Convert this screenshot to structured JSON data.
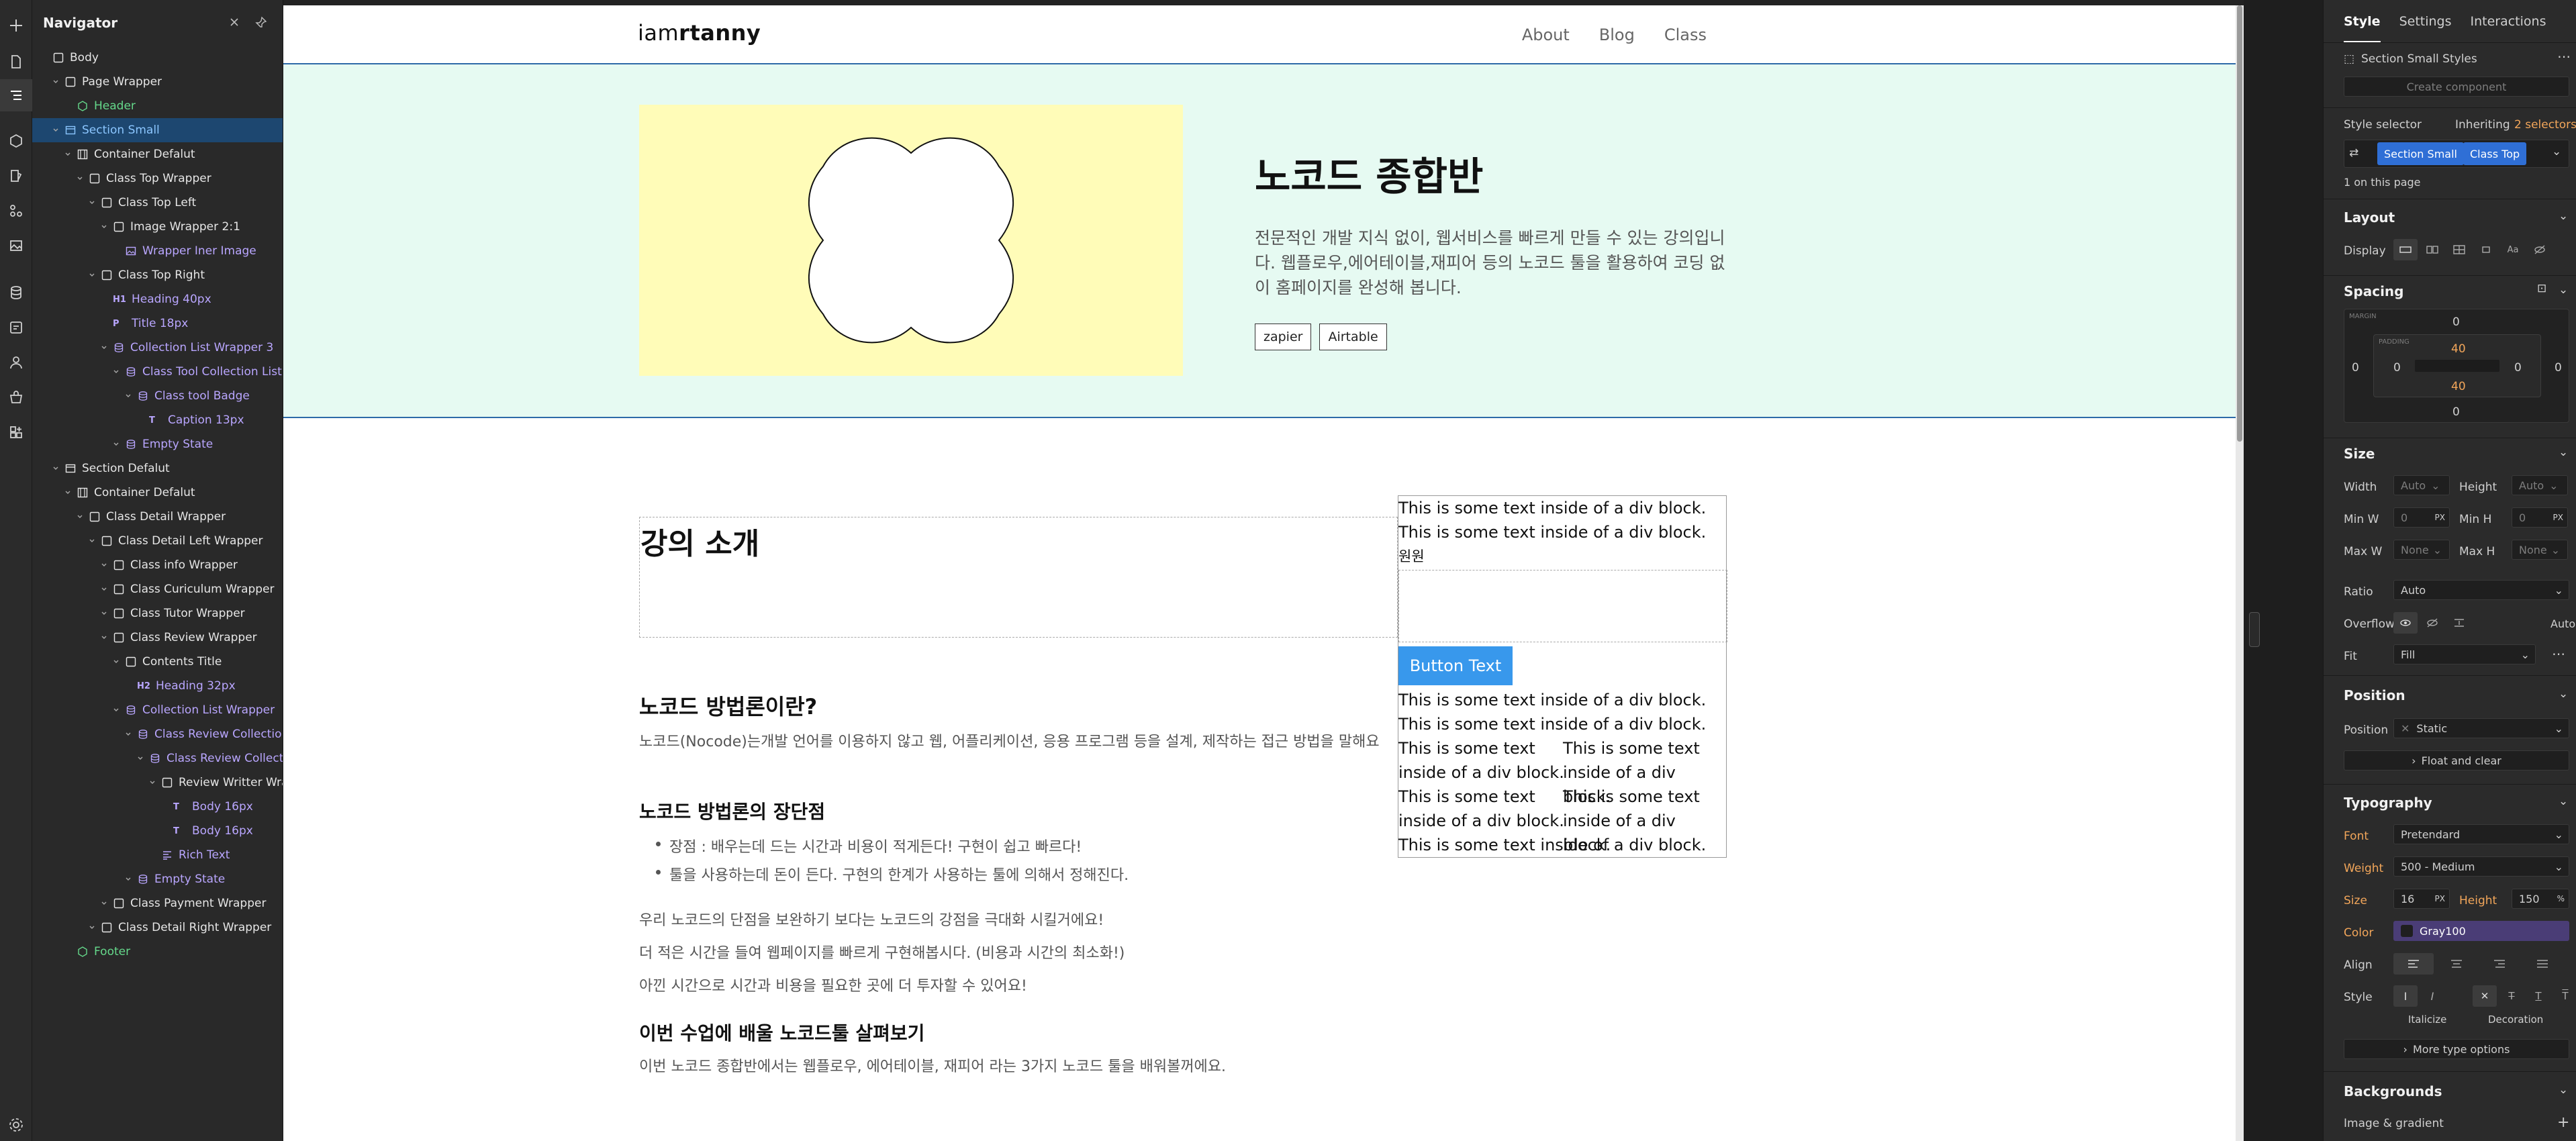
{
  "navigator": {
    "title": "Navigator",
    "tree": [
      {
        "label": "Body",
        "depth": 0,
        "chev": false,
        "icon": "box",
        "color": "w"
      },
      {
        "label": "Page Wrapper",
        "depth": 1,
        "chev": true,
        "icon": "box",
        "color": "w"
      },
      {
        "label": "Header",
        "depth": 2,
        "chev": false,
        "icon": "component",
        "color": "g"
      },
      {
        "label": "Section Small",
        "depth": 1,
        "chev": true,
        "icon": "section",
        "color": "b",
        "selected": true
      },
      {
        "label": "Container Defalut",
        "depth": 2,
        "chev": true,
        "icon": "container",
        "color": "w"
      },
      {
        "label": "Class Top Wrapper",
        "depth": 3,
        "chev": true,
        "icon": "box",
        "color": "w"
      },
      {
        "label": "Class Top Left",
        "depth": 4,
        "chev": true,
        "icon": "box",
        "color": "w"
      },
      {
        "label": "Image Wrapper 2:1",
        "depth": 5,
        "chev": true,
        "icon": "box",
        "color": "w"
      },
      {
        "label": "Wrapper Iner Image",
        "depth": 6,
        "chev": false,
        "icon": "image",
        "color": "p"
      },
      {
        "label": "Class Top Right",
        "depth": 4,
        "chev": true,
        "icon": "box",
        "color": "w"
      },
      {
        "label": "Heading 40px",
        "depth": 5,
        "chev": false,
        "tag": "H1",
        "color": "p"
      },
      {
        "label": "Title 18px",
        "depth": 5,
        "chev": false,
        "tag": "P",
        "color": "p"
      },
      {
        "label": "Collection List Wrapper 3",
        "depth": 5,
        "chev": true,
        "icon": "db",
        "color": "p"
      },
      {
        "label": "Class Tool Collection List",
        "depth": 6,
        "chev": true,
        "icon": "db",
        "color": "p"
      },
      {
        "label": "Class tool Badge",
        "depth": 7,
        "chev": true,
        "icon": "db",
        "color": "p"
      },
      {
        "label": "Caption 13px",
        "depth": 8,
        "chev": false,
        "tag": "T",
        "color": "p"
      },
      {
        "label": "Empty State",
        "depth": 6,
        "chev": true,
        "icon": "db",
        "color": "p"
      },
      {
        "label": "Section Defalut",
        "depth": 1,
        "chev": true,
        "icon": "section",
        "color": "w"
      },
      {
        "label": "Container Defalut",
        "depth": 2,
        "chev": true,
        "icon": "container",
        "color": "w"
      },
      {
        "label": "Class Detail Wrapper",
        "depth": 3,
        "chev": true,
        "icon": "box",
        "color": "w"
      },
      {
        "label": "Class Detail Left Wrapper",
        "depth": 4,
        "chev": true,
        "icon": "box",
        "color": "w"
      },
      {
        "label": "Class info Wrapper",
        "depth": 5,
        "chev": true,
        "icon": "box",
        "color": "w"
      },
      {
        "label": "Class Curiculum Wrapper",
        "depth": 5,
        "chev": true,
        "icon": "box",
        "color": "w"
      },
      {
        "label": "Class Tutor Wrapper",
        "depth": 5,
        "chev": true,
        "icon": "box",
        "color": "w"
      },
      {
        "label": "Class Review Wrapper",
        "depth": 5,
        "chev": true,
        "icon": "box",
        "color": "w"
      },
      {
        "label": "Contents Title",
        "depth": 6,
        "chev": true,
        "icon": "box",
        "color": "w"
      },
      {
        "label": "Heading 32px",
        "depth": 7,
        "chev": false,
        "tag": "H2",
        "color": "p"
      },
      {
        "label": "Collection List Wrapper",
        "depth": 6,
        "chev": true,
        "icon": "db",
        "color": "p"
      },
      {
        "label": "Class Review Collection",
        "depth": 7,
        "chev": true,
        "icon": "db",
        "color": "p"
      },
      {
        "label": "Class Review Collect",
        "depth": 8,
        "chev": true,
        "icon": "db",
        "color": "p"
      },
      {
        "label": "Review Writter Wra",
        "depth": 9,
        "chev": true,
        "icon": "box",
        "color": "w"
      },
      {
        "label": "Body 16px",
        "depth": 10,
        "chev": false,
        "tag": "T",
        "color": "p"
      },
      {
        "label": "Body 16px",
        "depth": 10,
        "chev": false,
        "tag": "T",
        "color": "p"
      },
      {
        "label": "Rich Text",
        "depth": 9,
        "chev": false,
        "icon": "rich",
        "color": "p"
      },
      {
        "label": "Empty State",
        "depth": 7,
        "chev": true,
        "icon": "db",
        "color": "p"
      },
      {
        "label": "Class Payment Wrapper",
        "depth": 5,
        "chev": true,
        "icon": "box",
        "color": "w"
      },
      {
        "label": "Class Detail Right Wrapper",
        "depth": 4,
        "chev": true,
        "icon": "box",
        "color": "w"
      },
      {
        "label": "Footer",
        "depth": 2,
        "chev": false,
        "icon": "component",
        "color": "g"
      }
    ]
  },
  "site": {
    "logo_light": "iam",
    "logo_bold": "rtanny",
    "menu": [
      "About",
      "Blog",
      "Class"
    ],
    "hero_title": "노코드 종합반",
    "hero_desc": "전문적인 개발 지식 없이, 웹서비스를 빠르게 만들 수 있는 강의입니다. 웹플로우,에어테이블,재피어 등의 노코드 툴을 활용하여 코딩 없이 홈페이지를 완성해 봅니다.",
    "badges": [
      "zapier",
      "Airtable"
    ],
    "intro_title": "강의 소개",
    "what_title": "노코드 방법론이란?",
    "what_desc": "노코드(Nocode)는개발 언어를 이용하지 않고 웹, 어플리케이션, 응용 프로그램 등을 설계, 제작하는 접근 방법을 말해요",
    "pros_title": "노코드 방법론의 장단점",
    "pros": [
      "장점 : 배우는데 드는 시간과 비용이 적게든다! 구현이 쉽고 빠르다!",
      "툴을 사용하는데 돈이 든다. 구현의 한계가 사용하는 툴에 의해서 정해진다."
    ],
    "para1": "우리 노코드의 단점을 보완하기 보다는 노코드의 강점을 극대화 시킬거에요!",
    "para2": "더 적은 시간을 들여 웹페이지를 빠르게 구현해봅시다. (비용과 시간의 최소화!)",
    "para3": "아낀 시간으로 시간과 비용을 필요한 곳에 더 투자할 수 있어요!",
    "tools_title": "이번 수업에 배울 노코드툴 살펴보기",
    "tools_desc": "이번 노코드 종합반에서는 웹플로우, 에어테이블, 재피어 라는 3가지 노코드 툴을 배워볼꺼에요.",
    "div_text": "This is some text inside of a div block.",
    "div_line1": "This is some text",
    "div_line2": "inside of a div block.",
    "won": "원원",
    "button_text": "Button Text"
  },
  "panel": {
    "tabs": [
      "Style",
      "Settings",
      "Interactions"
    ],
    "styles_name": "Section Small Styles",
    "create_component": "Create component",
    "style_selector": "Style selector",
    "inheriting": "Inheriting",
    "selectors_count": "2 selectors",
    "chips": [
      "Section Small",
      "Class Top"
    ],
    "on_page": "1 on this page",
    "layout": "Layout",
    "display": "Display",
    "spacing": "Spacing",
    "margin_label": "MARGIN",
    "padding_label": "PADDING",
    "margin": {
      "top": "0",
      "right": "0",
      "bottom": "0",
      "left": "0"
    },
    "padding": {
      "top": "40",
      "right": "0",
      "bottom": "40",
      "left": "0"
    },
    "size": "Size",
    "width": "Width",
    "height": "Height",
    "auto": "Auto",
    "min_w": "Min W",
    "min_h": "Min H",
    "max_w": "Max W",
    "max_h": "Max H",
    "zero": "0",
    "none": "None",
    "px": "PX",
    "ratio": "Ratio",
    "ratio_val": "Auto",
    "overflow": "Overflow",
    "overflow_auto": "Auto",
    "fit": "Fit",
    "fit_val": "Fill",
    "position": "Position",
    "position_val": "Static",
    "float_clear": "Float and clear",
    "typography": "Typography",
    "font": "Font",
    "font_val": "Pretendard",
    "weight": "Weight",
    "weight_val": "500 - Medium",
    "size_lbl": "Size",
    "size_val": "16",
    "height_lbl": "Height",
    "height_val": "150",
    "pct": "%",
    "color": "Color",
    "color_val": "Gray100",
    "align": "Align",
    "style": "Style",
    "italicize": "Italicize",
    "decoration": "Decoration",
    "more_type": "More type options",
    "backgrounds": "Backgrounds",
    "image_gradient": "Image & gradient"
  }
}
